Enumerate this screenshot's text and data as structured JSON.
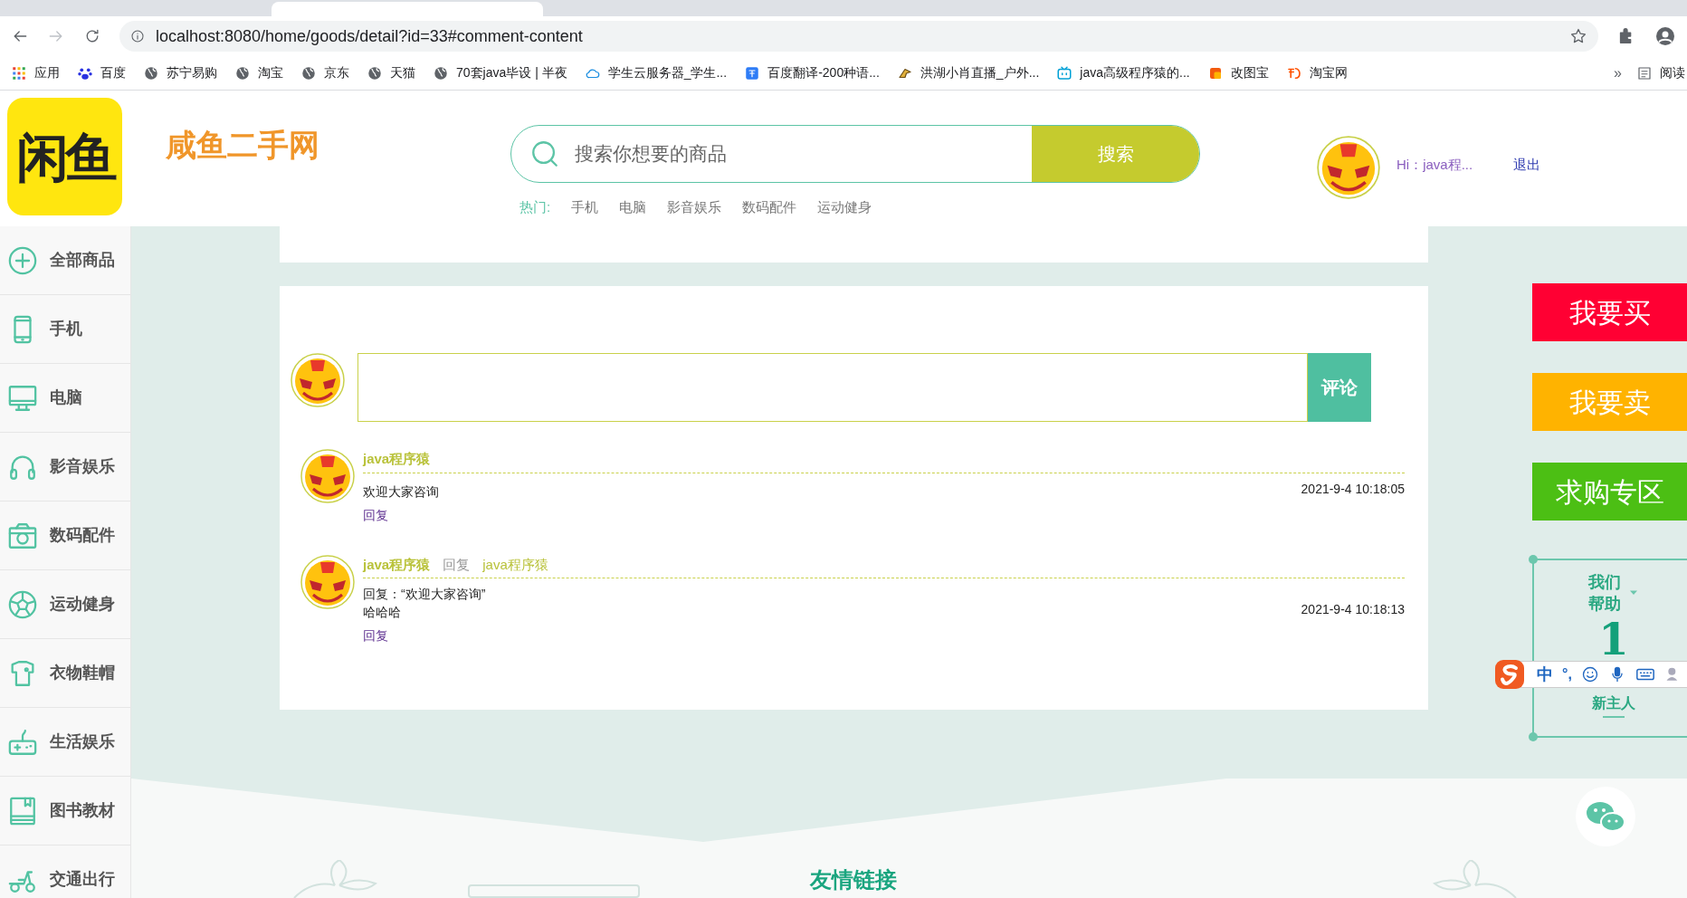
{
  "browser": {
    "url": "localhost:8080/home/goods/detail?id=33#comment-content",
    "bookmarks": [
      {
        "label": "应用",
        "kind": "apps"
      },
      {
        "label": "百度",
        "kind": "paw"
      },
      {
        "label": "苏宁易购",
        "kind": "globe"
      },
      {
        "label": "淘宝",
        "kind": "globe"
      },
      {
        "label": "京东",
        "kind": "globe"
      },
      {
        "label": "天猫",
        "kind": "globe"
      },
      {
        "label": "70套java毕设 | 半夜",
        "kind": "globe"
      },
      {
        "label": "学生云服务器_学生...",
        "kind": "cloud"
      },
      {
        "label": "百度翻译-200种语...",
        "kind": "translate"
      },
      {
        "label": "洪湖小肖直播_户外...",
        "kind": "bird"
      },
      {
        "label": "java高级程序猿的...",
        "kind": "tv"
      },
      {
        "label": "改图宝",
        "kind": "square"
      },
      {
        "label": "淘宝网",
        "kind": "tao"
      }
    ],
    "more": "»",
    "reading_list": "阅读"
  },
  "header": {
    "logo": "闲鱼",
    "site_title": "咸鱼二手网",
    "search": {
      "placeholder": "搜索你想要的商品",
      "button": "搜索"
    },
    "hot_label": "热门:",
    "hot_words": [
      "手机",
      "电脑",
      "影音娱乐",
      "数码配件",
      "运动健身"
    ],
    "greeting": "Hi：java程...",
    "logout": "退出"
  },
  "sidebar": {
    "items": [
      {
        "label": "全部商品",
        "kind": "plus"
      },
      {
        "label": "手机",
        "kind": "phone"
      },
      {
        "label": "电脑",
        "kind": "monitor"
      },
      {
        "label": "影音娱乐",
        "kind": "headphones"
      },
      {
        "label": "数码配件",
        "kind": "camera"
      },
      {
        "label": "运动健身",
        "kind": "ball"
      },
      {
        "label": "衣物鞋帽",
        "kind": "shirt"
      },
      {
        "label": "生活娱乐",
        "kind": "gamepad"
      },
      {
        "label": "图书教材",
        "kind": "book"
      },
      {
        "label": "交通出行",
        "kind": "scooter"
      }
    ]
  },
  "comment_form": {
    "button": "评论"
  },
  "comments": [
    {
      "author": "java程序猿",
      "lines": [
        "欢迎大家咨询"
      ],
      "time": "2021-9-4 10:18:05",
      "reply": "回复"
    },
    {
      "author": "java程序猿",
      "reply_word": "回复",
      "reply_to": "java程序猿",
      "lines": [
        "回复：“欢迎大家咨询”",
        "哈哈哈"
      ],
      "time": "2021-9-4 10:18:13",
      "reply": "回复"
    }
  ],
  "actions": [
    {
      "label": "我要买",
      "color": "#ff0033"
    },
    {
      "label": "我要卖",
      "color": "#ffb300"
    },
    {
      "label": "求购专区",
      "color": "#4cbf14"
    }
  ],
  "help_box": {
    "title_lines": [
      "我们",
      "帮助"
    ],
    "count": "1",
    "caption_lines": [
      "新主人"
    ]
  },
  "ime_bar": {
    "lang": "中",
    "punct": "°,"
  },
  "footer": {
    "title": "友情链接"
  }
}
